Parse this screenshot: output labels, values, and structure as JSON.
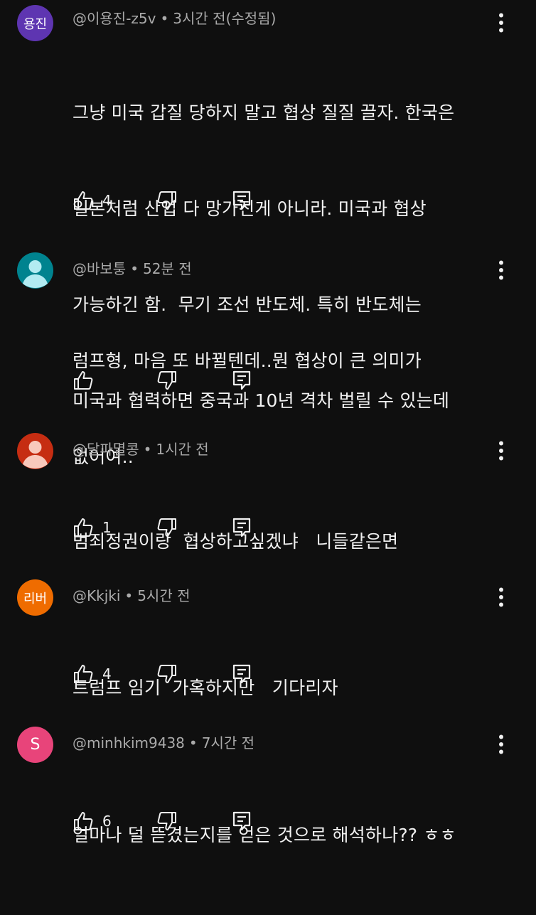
{
  "comments": [
    {
      "avatar_text": "용진",
      "avatar_color": "#5e35b1",
      "avatar_type": "initials",
      "handle": "@이용진-z5v",
      "time": "3시간 전(수정됨)",
      "lines": [
        "그냥 미국 갑질 당하지 말고 협상 질질 끌자. 한국은",
        "일본처럼 산업 다 망가진게 아니라. 미국과 협상",
        "가능하긴 함.  무기 조선 반도체. 특히 반도체는",
        "미국과 협력하면 중국과 10년 격차 벌릴 수 있는데"
      ],
      "likes": "4"
    },
    {
      "avatar_text": "",
      "avatar_color": "#00838f",
      "avatar_type": "person",
      "handle": "@바보퉁",
      "time": "52분 전",
      "lines": [
        "럼프형, 마음 또 바뀔텐데..뭔 협상이 큰 의미가",
        "없어여.."
      ],
      "likes": ""
    },
    {
      "avatar_text": "",
      "avatar_color": "#c62d12",
      "avatar_type": "person",
      "handle": "@달파멸콩",
      "time": "1시간 전",
      "lines": [
        "범죄정권이랑  협상하고싶겠냐   니들같은면"
      ],
      "likes": "1"
    },
    {
      "avatar_text": "리버",
      "avatar_color": "#ef6c00",
      "avatar_type": "initials",
      "handle": "@Kkjki",
      "time": "5시간 전",
      "lines": [
        "트럼프 임기  가혹하지만   기다리자"
      ],
      "likes": "4"
    },
    {
      "avatar_text": "S",
      "avatar_color": "#e8447a",
      "avatar_type": "initials",
      "handle": "@minhkim9438",
      "time": "7시간 전",
      "lines": [
        "얼마나 덜 뜯겼는지를 얻은 것으로 해석하나?? ㅎㅎ"
      ],
      "likes": "6"
    }
  ],
  "icons": {
    "like": "thumbs-up-icon",
    "dislike": "thumbs-down-icon",
    "reply": "reply-icon",
    "menu": "more-vert-icon"
  }
}
